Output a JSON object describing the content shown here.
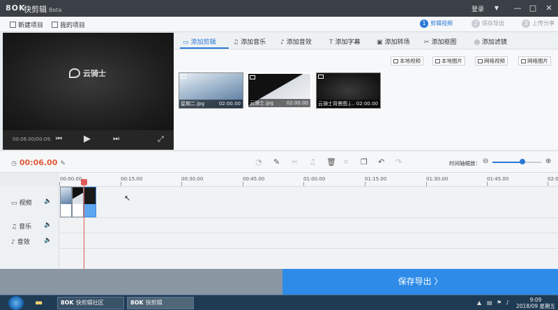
{
  "app": {
    "logo": "8OK",
    "title": "快剪辑",
    "beta": "Beta",
    "login": "登录",
    "min_icon": "—",
    "max_icon": "□",
    "close_icon": "✕",
    "menu_icon": "▼"
  },
  "toolbar": {
    "new_project": "新建项目",
    "my_projects": "我的项目"
  },
  "steps": [
    {
      "num": "1",
      "label": "剪辑视频"
    },
    {
      "num": "2",
      "label": "保存导出"
    },
    {
      "num": "3",
      "label": "上传分享"
    }
  ],
  "preview": {
    "brand": "云骑士",
    "timecode": "00:06.00/00:09."
  },
  "tabs": [
    {
      "icon": "▭",
      "label": "添加剪辑"
    },
    {
      "icon": "♫",
      "label": "添加音乐"
    },
    {
      "icon": "♪",
      "label": "添加音效"
    },
    {
      "icon": "T",
      "label": "添加字幕"
    },
    {
      "icon": "▣",
      "label": "添加转场"
    },
    {
      "icon": "✂",
      "label": "添加抠图"
    },
    {
      "icon": "◎",
      "label": "添加滤镜"
    }
  ],
  "sources": [
    "本地视频",
    "本地图片",
    "网络视频",
    "网络图片"
  ],
  "thumbnails": [
    {
      "name": "星期二.jpg",
      "duration": "02:00.00"
    },
    {
      "name": "云骑士.jpg",
      "duration": "02:00.00"
    },
    {
      "name": "云骑士背景图.j...",
      "duration": "02:00.00"
    }
  ],
  "editbar": {
    "current_time": "00:06.00",
    "zoom_label": "时间轴缩放：",
    "zoom_level": 0.62
  },
  "ruler": [
    "00:00.00",
    "00:15.00",
    "00:30.00",
    "00:45.00",
    "01:00.00",
    "01:15.00",
    "01:30.00",
    "01:45.00",
    "02:0"
  ],
  "tracks": [
    {
      "label": "视频",
      "icon": "▭"
    },
    {
      "label": "音乐",
      "icon": "♫"
    },
    {
      "label": "音效",
      "icon": "♪"
    }
  ],
  "export_label": "保存导出  〉",
  "taskbar": {
    "apps": [
      "快剪辑社区",
      "快剪辑"
    ],
    "time": "9:09",
    "date": "2018/09 星期五"
  },
  "colors": {
    "accent": "#2a7ad6",
    "time": "#e05a3a",
    "export": "#2e8be8"
  }
}
